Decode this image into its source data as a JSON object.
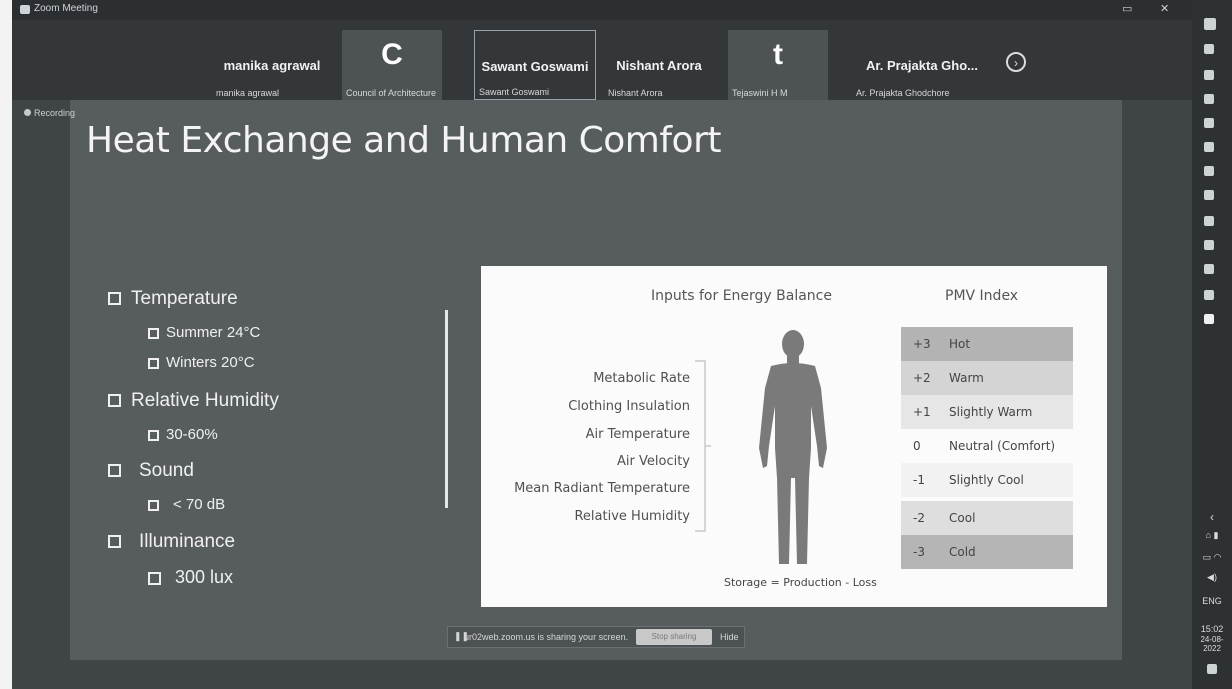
{
  "window": {
    "title": "Zoom Meeting",
    "recording_label": "Recording"
  },
  "participants": [
    {
      "name": "manika agrawal",
      "sub": "manika agrawal",
      "letter": ""
    },
    {
      "name": "",
      "sub": "Council of Architecture",
      "letter": "C"
    },
    {
      "name": "Sawant Goswami",
      "sub": "Sawant Goswami",
      "letter": ""
    },
    {
      "name": "Nishant Arora",
      "sub": "Nishant Arora",
      "letter": ""
    },
    {
      "name": "",
      "sub": "Tejaswini H M",
      "letter": "t"
    },
    {
      "name": "Ar. Prajakta Gho...",
      "sub": "Ar. Prajakta Ghodchore",
      "letter": ""
    }
  ],
  "slide": {
    "title": "Heat Exchange and Human Comfort",
    "bullets": {
      "temperature": "Temperature",
      "summer": "Summer 24°C",
      "winters": "Winters 20°C",
      "humidity": "Relative Humidity",
      "humidity_range": "30-60%",
      "sound": "Sound",
      "sound_value": "< 70 dB",
      "illuminance": "Illuminance",
      "illuminance_value": "300 lux"
    },
    "panel": {
      "inputs_title": "Inputs for Energy Balance",
      "pmv_title": "PMV Index",
      "inputs": [
        "Metabolic Rate",
        "Clothing Insulation",
        "Air Temperature",
        "Air Velocity",
        "Mean Radiant Temperature",
        "Relative Humidity"
      ],
      "storage": "Storage = Production - Loss",
      "pmv": [
        {
          "num": "+3",
          "label": "Hot",
          "color": "#b3b3b3"
        },
        {
          "num": "+2",
          "label": "Warm",
          "color": "#d4d4d4"
        },
        {
          "num": "+1",
          "label": "Slightly Warm",
          "color": "#e6e6e6"
        },
        {
          "num": "0",
          "label": "Neutral (Comfort)",
          "color": "#fbfbfb"
        },
        {
          "num": "-1",
          "label": "Slightly Cool",
          "color": "#f2f2f2"
        },
        {
          "num": "-2",
          "label": "Cool",
          "color": "#dedede"
        },
        {
          "num": "-3",
          "label": "Cold",
          "color": "#b5b5b5"
        }
      ]
    }
  },
  "share_bar": {
    "message": "ur02web.zoom.us is sharing your screen.",
    "stop_label": "Stop sharing",
    "hide_label": "Hide"
  },
  "taskbar": {
    "lang": "ENG",
    "time": "15:02",
    "date": "24-08-2022"
  }
}
